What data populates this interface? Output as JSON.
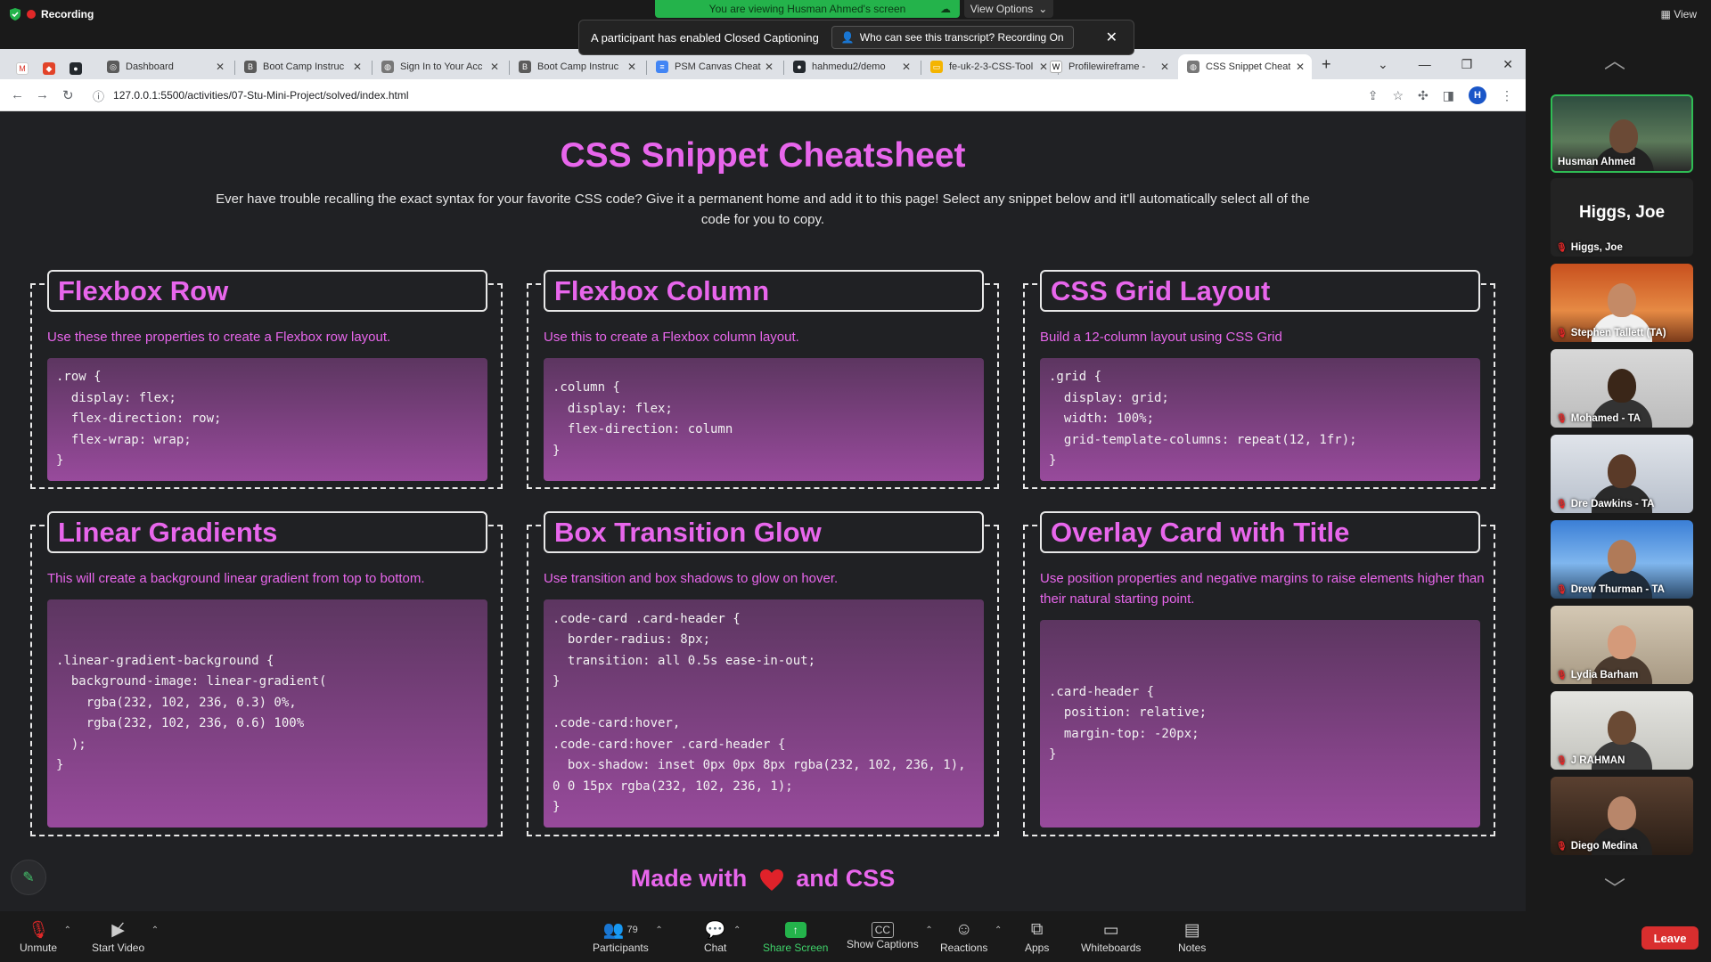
{
  "zoom": {
    "recording_label": "Recording",
    "viewing_banner": "You are viewing Husman Ahmed's screen",
    "view_options_label": "View Options",
    "view_label": "View",
    "cc_banner_text": "A participant has enabled Closed Captioning",
    "cc_who_label": "Who can see this transcript? Recording On",
    "participants_count": "79",
    "toolbar": {
      "unmute": "Unmute",
      "start_video": "Start Video",
      "participants": "Participants",
      "chat": "Chat",
      "share_screen": "Share Screen",
      "show_captions": "Show Captions",
      "reactions": "Reactions",
      "apps": "Apps",
      "whiteboards": "Whiteboards",
      "notes": "Notes",
      "leave": "Leave"
    },
    "participants": [
      {
        "name": "Husman Ahmed"
      },
      {
        "name": "Higgs, Joe",
        "display": "Higgs, Joe"
      },
      {
        "name": "Stephen Tallett (TA)"
      },
      {
        "name": "Mohamed - TA"
      },
      {
        "name": "Dre Dawkins - TA"
      },
      {
        "name": "Drew Thurman - TA"
      },
      {
        "name": "Lydia Barham"
      },
      {
        "name": "J RAHMAN"
      },
      {
        "name": "Diego Medina"
      }
    ],
    "speaker_color": "#2fbd54",
    "leave_color": "#d92e2e"
  },
  "browser": {
    "tabs": [
      {
        "label": "Dashboard",
        "icon": "canvas-icon"
      },
      {
        "label": "Boot Camp Instruc",
        "icon": "bootcamp-icon"
      },
      {
        "label": "Sign In to Your Acc",
        "icon": "globe-icon"
      },
      {
        "label": "Boot Camp Instruc",
        "icon": "bootcamp-icon"
      },
      {
        "label": "PSM Canvas Cheat",
        "icon": "docs-icon"
      },
      {
        "label": "hahmedu2/demo",
        "icon": "github-icon"
      },
      {
        "label": "fe-uk-2-3-CSS-Tool",
        "icon": "folder-icon"
      },
      {
        "label": "Profilewireframe - ",
        "icon": "wikipedia-icon"
      },
      {
        "label": "CSS Snippet Cheat",
        "icon": "globe-icon",
        "active": true
      }
    ],
    "url": "127.0.0.1:5500/activities/07-Stu-Mini-Project/solved/index.html",
    "profile_initial": "H"
  },
  "page": {
    "title": "CSS Snippet Cheatsheet",
    "description": "Ever have trouble recalling the exact syntax for your favorite CSS code? Give it a permanent home and add it to this page! Select any snippet below and it'll automatically select all of the code for you to copy.",
    "accent_color": "#e866ec",
    "cards": [
      {
        "title": "Flexbox Row",
        "desc": "Use these three properties to create a Flexbox row layout.",
        "code": ".row {\n  display: flex;\n  flex-direction: row;\n  flex-wrap: wrap;\n}"
      },
      {
        "title": "Flexbox Column",
        "desc": "Use this to create a Flexbox column layout.",
        "code": ".column {\n  display: flex;\n  flex-direction: column\n}"
      },
      {
        "title": "CSS Grid Layout",
        "desc": "Build a 12-column layout using CSS Grid",
        "code": ".grid {\n  display: grid;\n  width: 100%;\n  grid-template-columns: repeat(12, 1fr);\n}"
      },
      {
        "title": "Linear Gradients",
        "desc": "This will create a background linear gradient from top to bottom.",
        "code": ".linear-gradient-background {\n  background-image: linear-gradient(\n    rgba(232, 102, 236, 0.3) 0%,\n    rgba(232, 102, 236, 0.6) 100%\n  );\n}"
      },
      {
        "title": "Box Transition Glow",
        "desc": "Use transition and box shadows to glow on hover.",
        "code": ".code-card .card-header {\n  border-radius: 8px;\n  transition: all 0.5s ease-in-out;\n}\n\n.code-card:hover,\n.code-card:hover .card-header {\n  box-shadow: inset 0px 0px 8px rgba(232, 102, 236, 1),\n0 0 15px rgba(232, 102, 236, 1);\n}"
      },
      {
        "title": "Overlay Card with Title",
        "desc": "Use position properties and negative margins to raise elements higher than their natural starting point.",
        "code": ".card-header {\n  position: relative;\n  margin-top: -20px;\n}"
      }
    ],
    "footer_before": "Made with",
    "footer_after": "and CSS"
  }
}
